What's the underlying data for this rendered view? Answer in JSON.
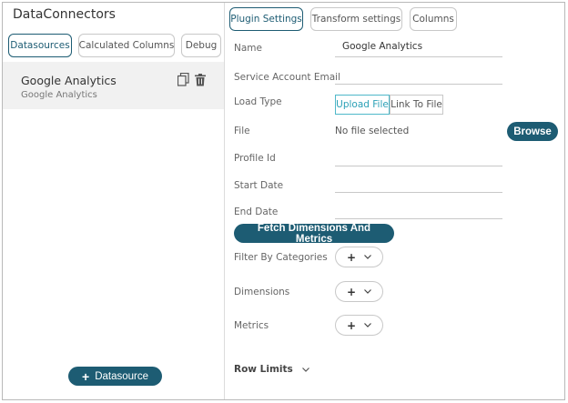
{
  "app_title": "DataConnectors",
  "left_tabs": [
    {
      "label": "Datasources"
    },
    {
      "label": "Calculated Columns"
    },
    {
      "label": "Debug"
    }
  ],
  "datasource": {
    "name": "Google Analytics",
    "subtitle": "Google Analytics"
  },
  "add_datasource_label": "Datasource",
  "right_tabs": [
    {
      "label": "Plugin Settings"
    },
    {
      "label": "Transform settings"
    },
    {
      "label": "Columns"
    }
  ],
  "form": {
    "name_label": "Name",
    "name_value": "Google Analytics",
    "service_email_label": "Service Account Email",
    "service_email_value": "",
    "load_type_label": "Load Type",
    "load_type_options": [
      "Upload File",
      "Link To File"
    ],
    "file_label": "File",
    "file_value": "No file selected",
    "browse_label": "Browse",
    "profile_id_label": "Profile Id",
    "profile_id_value": "",
    "start_date_label": "Start Date",
    "start_date_value": "",
    "end_date_label": "End Date",
    "end_date_value": "",
    "fetch_label": "Fetch Dimensions And Metrics",
    "filter_label": "Filter By Categories",
    "dimensions_label": "Dimensions",
    "metrics_label": "Metrics",
    "plus_symbol": "+",
    "row_limits_label": "Row Limits"
  },
  "colors": {
    "accent": "#1d5c73",
    "active_segment": "#2aa0b6",
    "selected_item_bg": "#f1f1f1"
  },
  "icons": {
    "copy": "copy-icon",
    "delete": "trash-icon",
    "dropdown": "chevron-down-icon",
    "add": "plus-icon"
  }
}
